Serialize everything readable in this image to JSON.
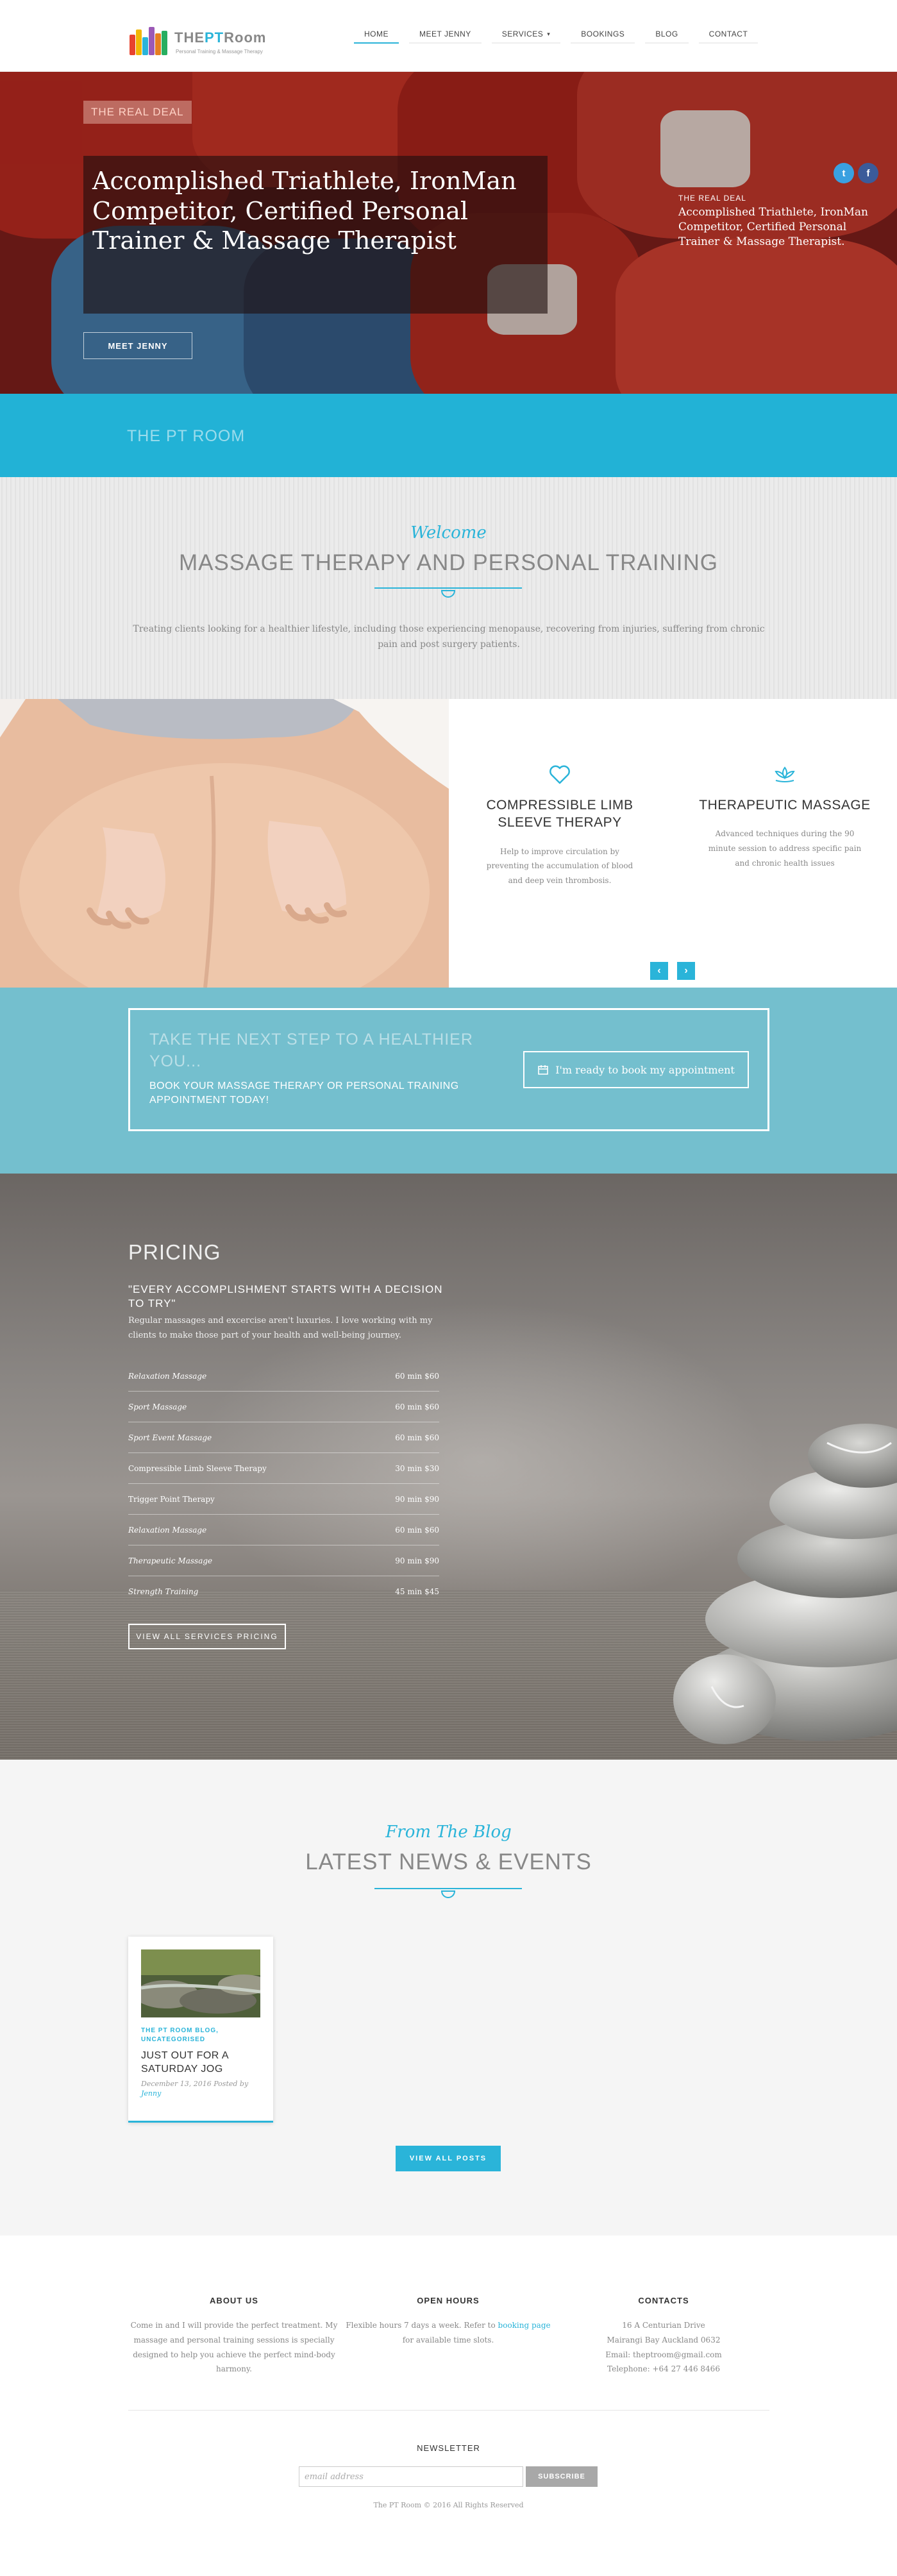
{
  "header": {
    "logo": {
      "brand_left": "THE",
      "brand_mid": "PT",
      "brand_right": "Room",
      "tagline": "Personal Training & Massage Therapy"
    },
    "nav": [
      {
        "label": "HOME",
        "active": true
      },
      {
        "label": "MEET JENNY",
        "active": false
      },
      {
        "label": "SERVICES",
        "active": false,
        "dropdown": true
      },
      {
        "label": "BOOKINGS",
        "active": false
      },
      {
        "label": "BLOG",
        "active": false
      },
      {
        "label": "CONTACT",
        "active": false
      }
    ]
  },
  "hero": {
    "badge": "THE REAL DEAL",
    "headline": "Accomplished Triathlete, IronMan Competitor, Certified Personal Trainer & Massage Therapist",
    "button": "MEET JENNY",
    "side_kicker": "THE REAL DEAL",
    "side_text": "Accomplished Triathlete, IronMan Competitor, Certified Personal Trainer & Massage Therapist.",
    "social": [
      {
        "icon": "twitter-icon",
        "color": "#3aa0e0"
      },
      {
        "icon": "facebook-icon",
        "color": "#3b5b9a"
      }
    ]
  },
  "band": {
    "title": "THE PT ROOM"
  },
  "welcome": {
    "script": "Welcome",
    "title": "MASSAGE THERAPY AND PERSONAL TRAINING",
    "text": "Treating clients looking for a healthier lifestyle, including those experiencing menopause, recovering from injuries, suffering from chronic pain and post surgery patients."
  },
  "features": [
    {
      "icon": "heart-icon",
      "title": "COMPRESSIBLE LIMB SLEEVE THERAPY",
      "text": "Help to improve circulation by preventing the accumulation of blood and deep vein thrombosis."
    },
    {
      "icon": "lotus-icon",
      "title": "THERAPEUTIC MASSAGE",
      "text": "Advanced techniques during the 90 minute session to address specific pain and chronic health issues"
    }
  ],
  "cta": {
    "big": "TAKE THE NEXT STEP TO A HEALTHIER YOU...",
    "small": "BOOK YOUR MASSAGE THERAPY OR PERSONAL TRAINING APPOINTMENT TODAY!",
    "button": "I'm ready to book my appointment"
  },
  "pricing": {
    "title": "PRICING",
    "quote": "\"EVERY ACCOMPLISHMENT STARTS WITH A DECISION TO TRY\"",
    "intro": "Regular massages and excercise aren't luxuries. I love working with my clients to make those part of your health and well-being journey.",
    "items": [
      {
        "name": "Relaxation Massage",
        "price": "60 min $60",
        "italic": true
      },
      {
        "name": "Sport Massage",
        "price": "60 min $60",
        "italic": true
      },
      {
        "name": "Sport Event Massage",
        "price": "60 min $60",
        "italic": true
      },
      {
        "name": "Compressible Limb Sleeve Therapy",
        "price": "30 min $30",
        "italic": false
      },
      {
        "name": "Trigger Point Therapy",
        "price": "90 min $90",
        "italic": false
      },
      {
        "name": "Relaxation Massage",
        "price": "60 min $60",
        "italic": true
      },
      {
        "name": "Therapeutic Massage",
        "price": "90 min $90",
        "italic": true
      },
      {
        "name": "Strength Training",
        "price": "45 min $45",
        "italic": true
      }
    ],
    "button": "VIEW ALL SERVICES PRICING"
  },
  "blog": {
    "script": "From The Blog",
    "title": "LATEST NEWS & EVENTS",
    "post": {
      "categories": "THE PT ROOM BLOG, UNCATEGORISED",
      "title": "JUST OUT FOR A SATURDAY JOG",
      "meta": "December 13, 2016 Posted by",
      "author": "Jenny"
    },
    "button": "VIEW ALL POSTS"
  },
  "footer": {
    "about": {
      "title": "ABOUT US",
      "text": "Come in and I will provide the perfect treatment. My massage and personal training sessions is specially designed to help you achieve the perfect mind-body harmony."
    },
    "hours": {
      "title": "OPEN HOURS",
      "text_a": "Flexible hours 7 days a week. Refer to ",
      "link": "booking page",
      "text_b": " for available time slots."
    },
    "contacts": {
      "title": "CONTACTS",
      "lines": [
        "16 A Centurian Drive",
        "Mairangi Bay Auckland 0632",
        "Email: theptroom@gmail.com",
        "Telephone: +64 27 446 8466"
      ]
    },
    "newsletter": {
      "title": "NEWSLETTER",
      "placeholder": "email address",
      "button": "SUBSCRIBE"
    },
    "copyright": "The PT Room © 2016 All Rights Reserved"
  },
  "colors": {
    "accent": "#2ab4d9",
    "cta_bg": "#74bfce",
    "band": "#22b2d6"
  }
}
